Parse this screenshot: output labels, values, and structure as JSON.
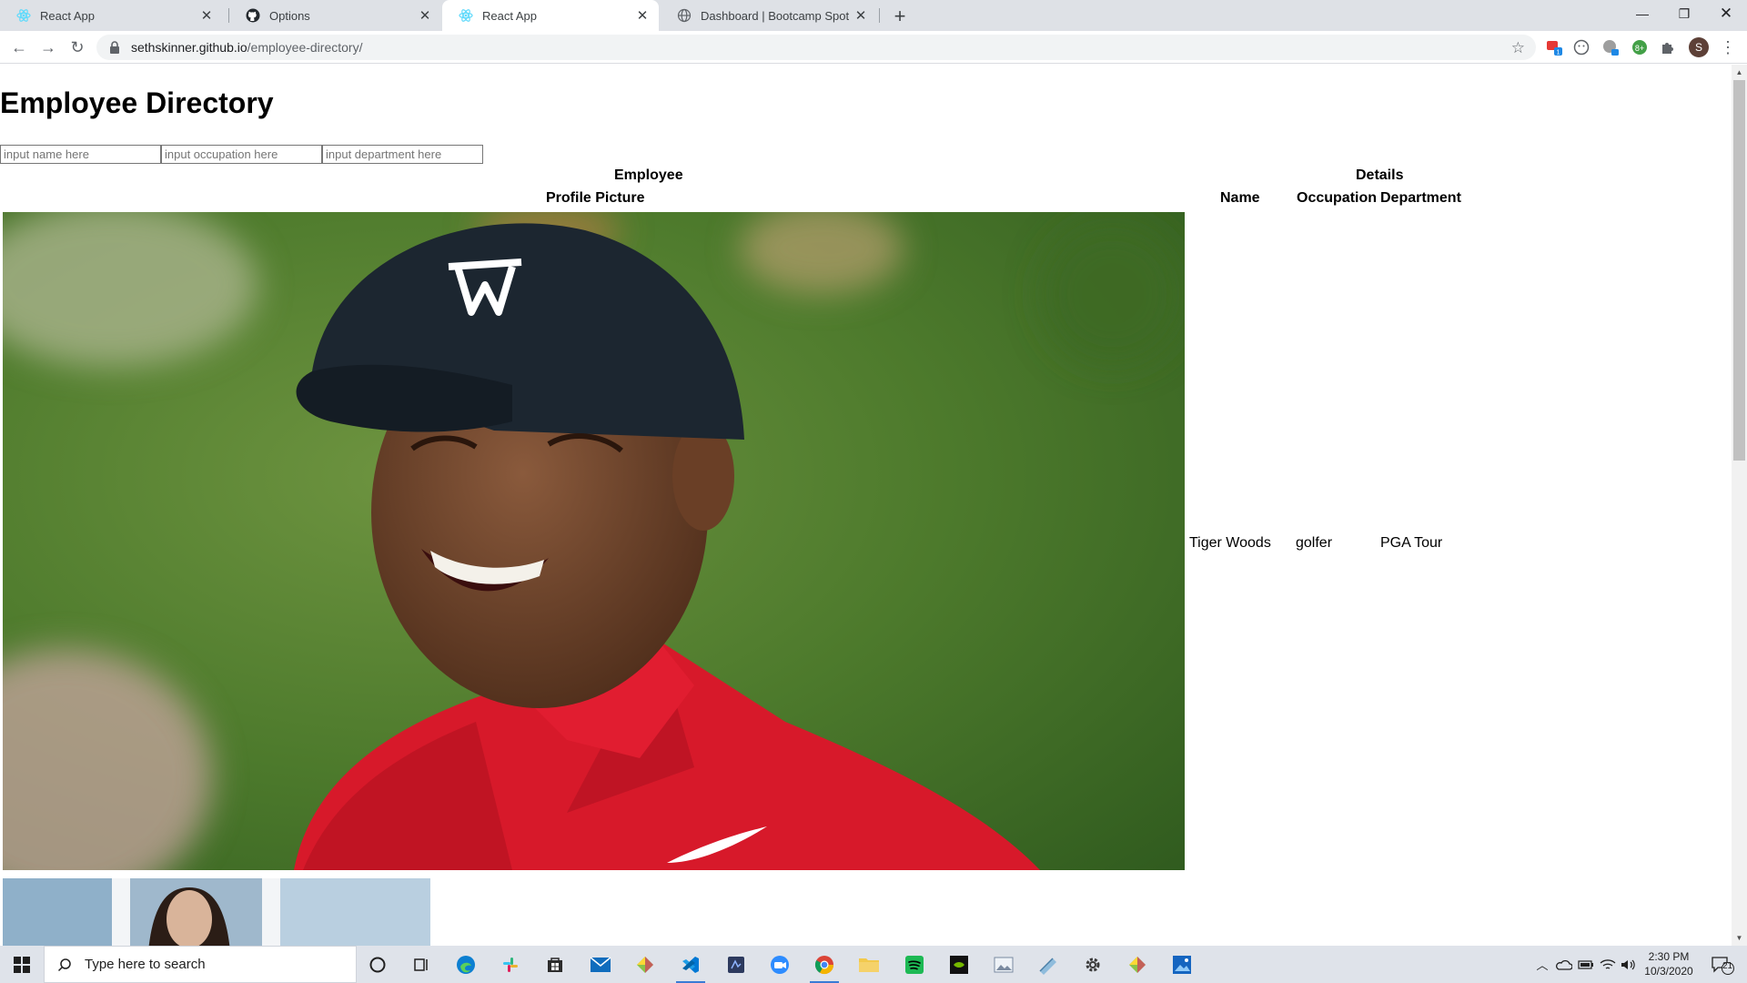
{
  "browser": {
    "tabs": [
      {
        "title": "React App",
        "icon": "react-icon",
        "active": false
      },
      {
        "title": "Options",
        "icon": "github-icon",
        "active": false
      },
      {
        "title": "React App",
        "icon": "react-icon",
        "active": true
      },
      {
        "title": "Dashboard | Bootcamp Spot",
        "icon": "globe-icon",
        "active": false
      }
    ],
    "url_host": "sethskinner.github.io",
    "url_path": "/employee-directory/",
    "profile_initial": "S"
  },
  "page": {
    "title": "Employee Directory",
    "filters": {
      "name_placeholder": "input name here",
      "occupation_placeholder": "input occupation here",
      "department_placeholder": "input department here"
    },
    "table": {
      "group_headers": [
        "Employee",
        "Details"
      ],
      "columns": [
        "Profile Picture",
        "Name",
        "Occupation",
        "Department"
      ],
      "rows": [
        {
          "name": "Tiger Woods",
          "occupation": "golfer",
          "department": "PGA Tour"
        }
      ]
    }
  },
  "taskbar": {
    "search_placeholder": "Type here to search",
    "time": "2:30 PM",
    "date": "10/3/2020",
    "notification_count": "21",
    "apps": [
      "cortana-icon",
      "task-view-icon",
      "edge-icon",
      "slack-icon",
      "store-icon",
      "mail-icon",
      "sourcetree-icon",
      "vscode-icon",
      "app-icon",
      "zoom-icon",
      "chrome-icon",
      "file-explorer-icon",
      "spotify-icon",
      "nvidia-icon",
      "photos-icon",
      "snip-icon",
      "settings-icon",
      "sourcetree-icon",
      "photo-app-icon"
    ]
  },
  "colors": {
    "tab_strip": "#dee1e6",
    "omnibox": "#f1f3f4",
    "taskbar": "#dfe3ea",
    "shirt_red": "#d7192a",
    "cap_navy": "#1c2630"
  }
}
